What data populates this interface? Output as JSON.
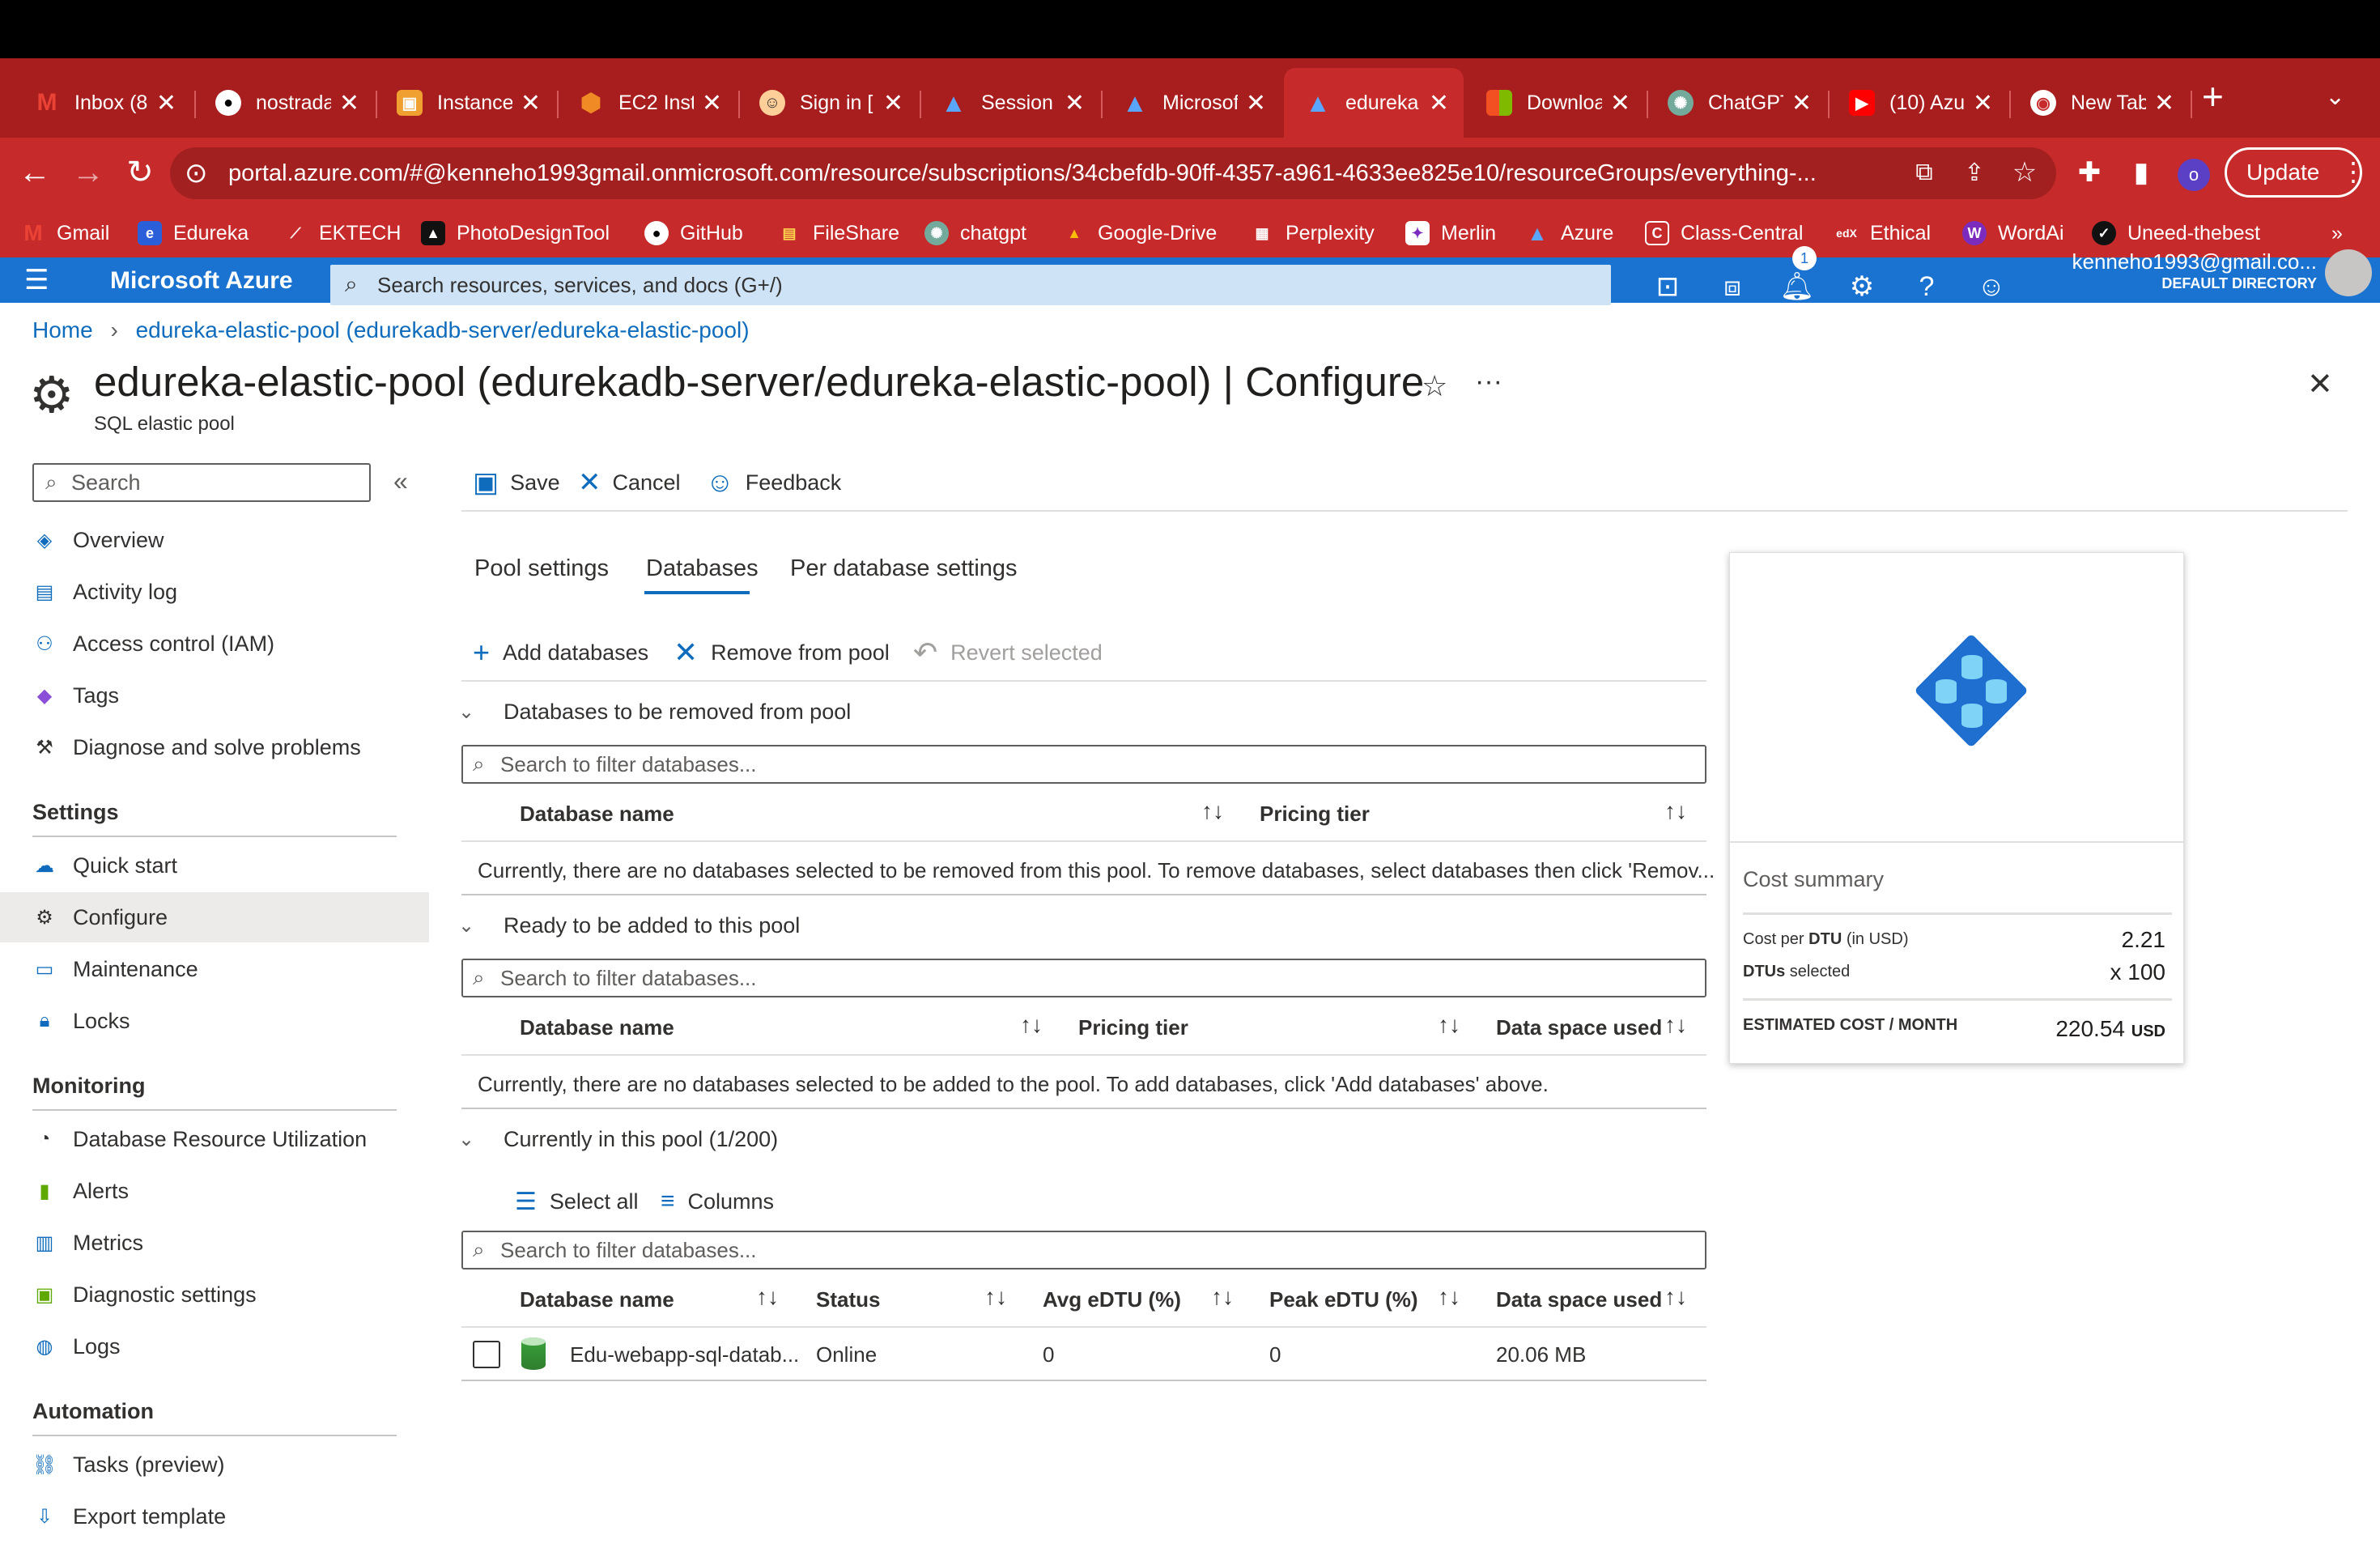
{
  "browser": {
    "tabs": [
      {
        "title": "Inbox (8",
        "icon": "gmail-icon",
        "color": "#ea4335"
      },
      {
        "title": "nostrada",
        "icon": "github-icon",
        "color": "#ffffff"
      },
      {
        "title": "Instance",
        "icon": "instance-icon",
        "color": "#f0a030"
      },
      {
        "title": "EC2 Inst",
        "icon": "aws-icon",
        "color": "#f08a24"
      },
      {
        "title": "Sign in [",
        "icon": "signin-icon",
        "color": "#ffcf99"
      },
      {
        "title": "Session",
        "icon": "azure-icon",
        "color": "#2a7ae2"
      },
      {
        "title": "Microsof",
        "icon": "azure-icon",
        "color": "#2a7ae2"
      },
      {
        "title": "edureka",
        "icon": "azure-icon",
        "color": "#2a7ae2",
        "active": true
      },
      {
        "title": "Downloa",
        "icon": "microsoft-icon",
        "color": "#f25022"
      },
      {
        "title": "ChatGPT",
        "icon": "chatgpt-icon",
        "color": "#74aa9c"
      },
      {
        "title": "(10) Azu",
        "icon": "youtube-icon",
        "color": "#ff0000"
      },
      {
        "title": "New Tab",
        "icon": "chrome-icon",
        "color": "#ffffff"
      }
    ],
    "url": "portal.azure.com/#@kenneho1993gmail.onmicrosoft.com/resource/subscriptions/34cbefdb-90ff-4357-a961-4633ee825e10/resourceGroups/everything-...",
    "update_label": "Update",
    "profile_initial": "o",
    "bookmarks": [
      {
        "label": "Gmail",
        "icon": "gmail-icon"
      },
      {
        "label": "Edureka",
        "icon": "edureka-icon"
      },
      {
        "label": "EKTECH",
        "icon": "ektech-icon"
      },
      {
        "label": "PhotoDesignTool",
        "icon": "photodesign-icon"
      },
      {
        "label": "GitHub",
        "icon": "github-icon"
      },
      {
        "label": "FileShare",
        "icon": "fileshare-icon"
      },
      {
        "label": "chatgpt",
        "icon": "chatgpt-icon"
      },
      {
        "label": "Google-Drive",
        "icon": "google-drive-icon"
      },
      {
        "label": "Perplexity",
        "icon": "perplexity-icon"
      },
      {
        "label": "Merlin",
        "icon": "merlin-icon"
      },
      {
        "label": "Azure",
        "icon": "azure-icon"
      },
      {
        "label": "Class-Central",
        "icon": "class-central-icon"
      },
      {
        "label": "Ethical",
        "icon": "edx-icon"
      },
      {
        "label": "WordAi",
        "icon": "wordai-icon"
      },
      {
        "label": "Uneed-thebest",
        "icon": "uneed-icon"
      }
    ],
    "more_bookmarks": "»"
  },
  "portal": {
    "brand": "Microsoft Azure",
    "search_placeholder": "Search resources, services, and docs (G+/)",
    "notification_count": "1",
    "account_email": "kenneho1993@gmail.co...",
    "account_directory": "DEFAULT DIRECTORY"
  },
  "breadcrumb": {
    "home": "Home",
    "current": "edureka-elastic-pool (edurekadb-server/edureka-elastic-pool)"
  },
  "page": {
    "title": "edureka-elastic-pool (edurekadb-server/edureka-elastic-pool) | Configure",
    "subtitle": "SQL elastic pool"
  },
  "sidebar": {
    "search_placeholder": "Search",
    "items_top": [
      {
        "label": "Overview",
        "icon": "overview-icon"
      },
      {
        "label": "Activity log",
        "icon": "activity-log-icon"
      },
      {
        "label": "Access control (IAM)",
        "icon": "iam-icon"
      },
      {
        "label": "Tags",
        "icon": "tag-icon"
      },
      {
        "label": "Diagnose and solve problems",
        "icon": "wrench-icon"
      }
    ],
    "settings_header": "Settings",
    "settings_items": [
      {
        "label": "Quick start",
        "icon": "quickstart-icon"
      },
      {
        "label": "Configure",
        "icon": "gear-icon",
        "selected": true
      },
      {
        "label": "Maintenance",
        "icon": "maintenance-icon"
      },
      {
        "label": "Locks",
        "icon": "lock-icon"
      }
    ],
    "monitoring_header": "Monitoring",
    "monitoring_items": [
      {
        "label": "Database Resource Utilization",
        "icon": "gauge-icon"
      },
      {
        "label": "Alerts",
        "icon": "alert-icon"
      },
      {
        "label": "Metrics",
        "icon": "metrics-icon"
      },
      {
        "label": "Diagnostic settings",
        "icon": "diagnostic-icon"
      },
      {
        "label": "Logs",
        "icon": "logs-icon"
      }
    ],
    "automation_header": "Automation",
    "automation_items": [
      {
        "label": "Tasks (preview)",
        "icon": "tasks-icon"
      },
      {
        "label": "Export template",
        "icon": "export-icon"
      }
    ]
  },
  "toolbar": {
    "save": "Save",
    "cancel": "Cancel",
    "feedback": "Feedback"
  },
  "tabs": {
    "pool_settings": "Pool settings",
    "databases": "Databases",
    "per_database": "Per database settings"
  },
  "actions": {
    "add": "Add databases",
    "remove": "Remove from pool",
    "revert": "Revert selected"
  },
  "sections": {
    "remove": {
      "header": "Databases to be removed from pool",
      "filter_placeholder": "Search to filter databases...",
      "columns": [
        "Database name",
        "Pricing tier"
      ],
      "empty": "Currently, there are no databases selected to be removed from this pool. To remove databases, select databases then click 'Remov..."
    },
    "add": {
      "header": "Ready to be added to this pool",
      "filter_placeholder": "Search to filter databases...",
      "columns": [
        "Database name",
        "Pricing tier",
        "Data space used"
      ],
      "empty": "Currently, there are no databases selected to be added to the pool. To add databases, click 'Add databases' above."
    },
    "current": {
      "header": "Currently in this pool (1/200)",
      "select_all": "Select all",
      "columns_btn": "Columns",
      "filter_placeholder": "Search to filter databases...",
      "columns": [
        "Database name",
        "Status",
        "Avg eDTU (%)",
        "Peak eDTU (%)",
        "Data space used"
      ],
      "rows": [
        {
          "name": "Edu-webapp-sql-datab...",
          "status": "Online",
          "avg": "0",
          "peak": "0",
          "space": "20.06 MB"
        }
      ]
    }
  },
  "cost_summary": {
    "title": "Cost summary",
    "cost_per_dtu_label_bold": "DTU",
    "cost_per_dtu_prefix": "Cost per ",
    "cost_per_dtu_suffix": " (in USD)",
    "cost_per_dtu": "2.21",
    "dtus_label_bold": "DTUs",
    "dtus_label_suffix": " selected",
    "dtus_value": "x 100",
    "estimated_label": "ESTIMATED COST / MONTH",
    "estimated_value": "220.54",
    "currency": "USD"
  }
}
